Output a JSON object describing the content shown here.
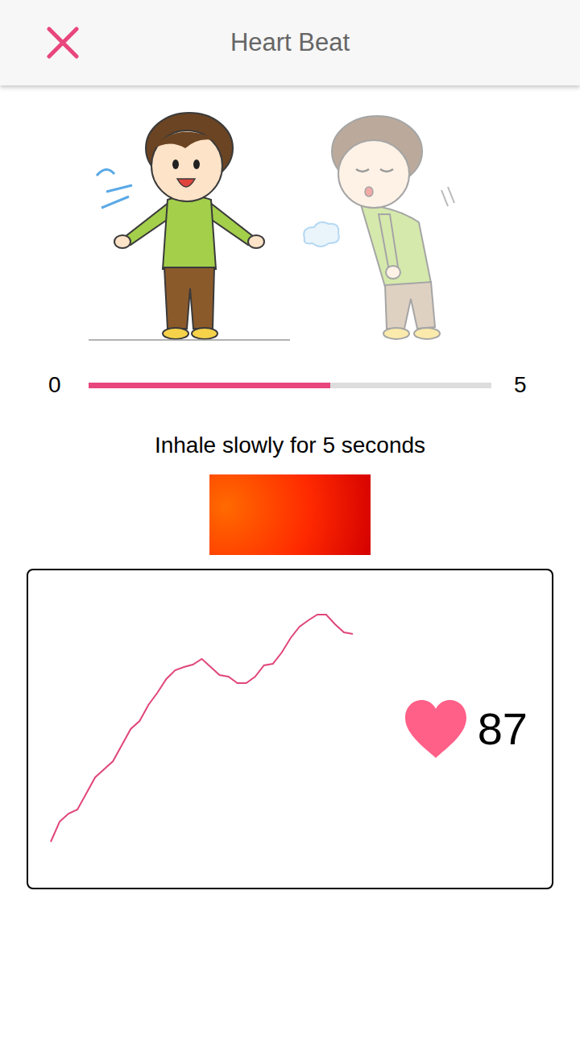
{
  "header": {
    "title": "Heart Beat"
  },
  "illustration": [
    {
      "kind": "inhale",
      "active": true
    },
    {
      "kind": "exhale",
      "active": false
    }
  ],
  "progress": {
    "min": "0",
    "max": "5",
    "level": 0.6
  },
  "instruction": "Inhale slowly for 5 seconds",
  "chart": {
    "values": [
      55,
      80,
      90,
      95,
      115,
      135,
      145,
      155,
      175,
      195,
      205,
      225,
      240,
      257,
      268,
      272,
      275,
      282,
      272,
      262,
      260,
      252,
      252,
      260,
      274,
      276,
      290,
      308,
      322,
      330,
      337,
      337,
      325,
      315,
      313
    ],
    "reading": "87"
  }
}
